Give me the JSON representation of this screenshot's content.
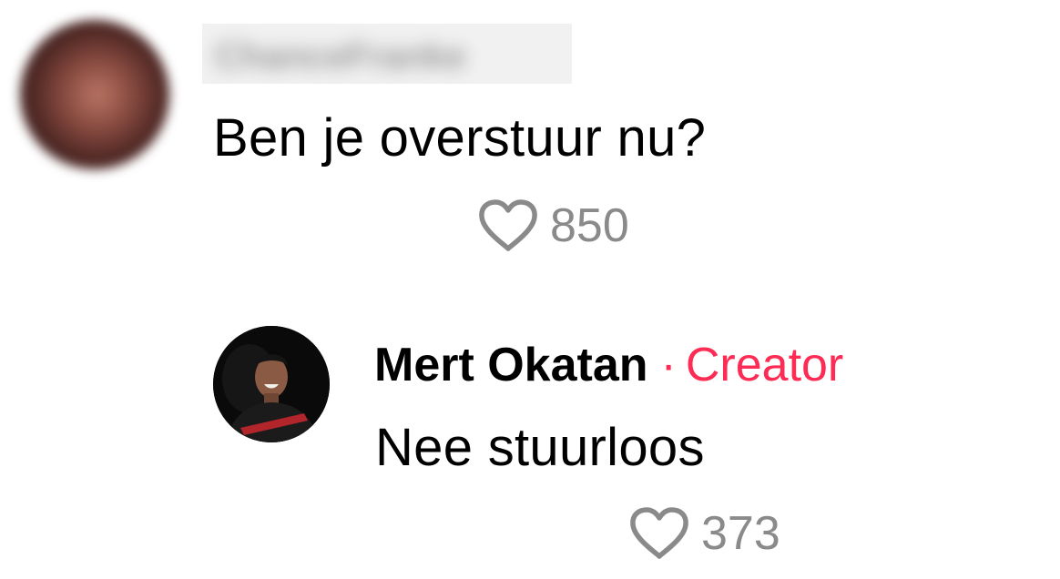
{
  "comment": {
    "author": "ChanceFranke",
    "text": "Ben je overstuur nu?",
    "likes": "850",
    "like_icon": "heart-outline-icon"
  },
  "reply": {
    "author": "Mert Okatan",
    "separator": "·",
    "badge": "Creator",
    "text": "Nee stuurloos",
    "likes": "373",
    "like_icon": "heart-outline-icon"
  },
  "colors": {
    "creator_badge": "#fe2c55",
    "like_count": "#8a8a8a",
    "text": "#000000",
    "background": "#ffffff"
  }
}
